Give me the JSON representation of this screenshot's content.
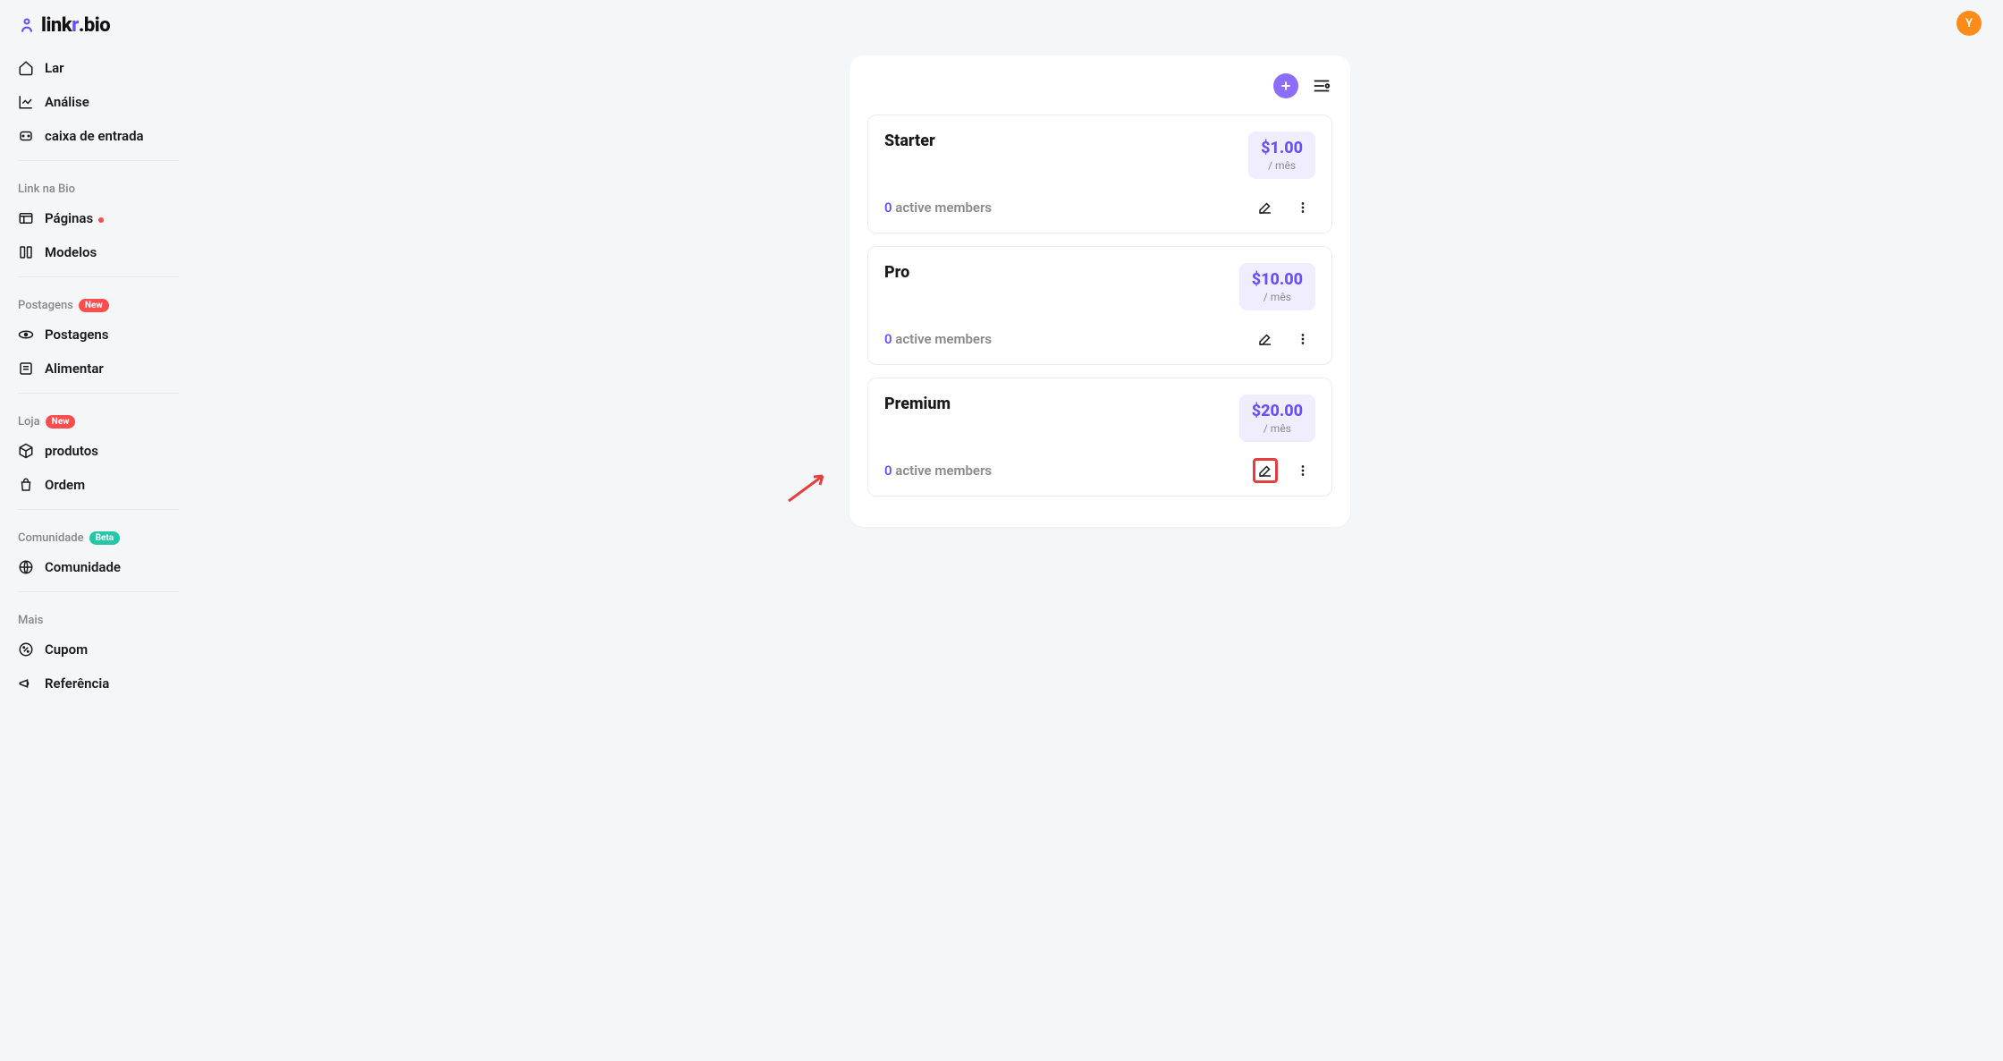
{
  "brand": {
    "part1": "link",
    "part2": "r",
    "part3": ".bio"
  },
  "user": {
    "initial": "Y"
  },
  "nav": {
    "top": [
      {
        "label": "Lar",
        "icon": "home"
      },
      {
        "label": "Análise",
        "icon": "chart"
      },
      {
        "label": "caixa de entrada",
        "icon": "inbox"
      }
    ],
    "sections": [
      {
        "title": "Link na Bio",
        "badge": null,
        "items": [
          {
            "label": "Páginas",
            "icon": "page",
            "dot": true
          },
          {
            "label": "Modelos",
            "icon": "template"
          }
        ]
      },
      {
        "title": "Postagens",
        "badge": "New",
        "badgeClass": "badge-new",
        "items": [
          {
            "label": "Postagens",
            "icon": "orbit"
          },
          {
            "label": "Alimentar",
            "icon": "feed"
          }
        ]
      },
      {
        "title": "Loja",
        "badge": "New",
        "badgeClass": "badge-new",
        "items": [
          {
            "label": "produtos",
            "icon": "box"
          },
          {
            "label": "Ordem",
            "icon": "bag"
          }
        ]
      },
      {
        "title": "Comunidade",
        "badge": "Beta",
        "badgeClass": "badge-beta",
        "items": [
          {
            "label": "Comunidade",
            "icon": "globe"
          }
        ]
      },
      {
        "title": "Mais",
        "badge": null,
        "items": [
          {
            "label": "Cupom",
            "icon": "coupon"
          },
          {
            "label": "Referência",
            "icon": "megaphone"
          }
        ]
      }
    ]
  },
  "tiers": [
    {
      "name": "Starter",
      "price": "$1.00",
      "period": "/ mês",
      "count": "0",
      "members_label": "active members",
      "highlightEdit": false
    },
    {
      "name": "Pro",
      "price": "$10.00",
      "period": "/ mês",
      "count": "0",
      "members_label": "active members",
      "highlightEdit": false
    },
    {
      "name": "Premium",
      "price": "$20.00",
      "period": "/ mês",
      "count": "0",
      "members_label": "active members",
      "highlightEdit": true
    }
  ]
}
